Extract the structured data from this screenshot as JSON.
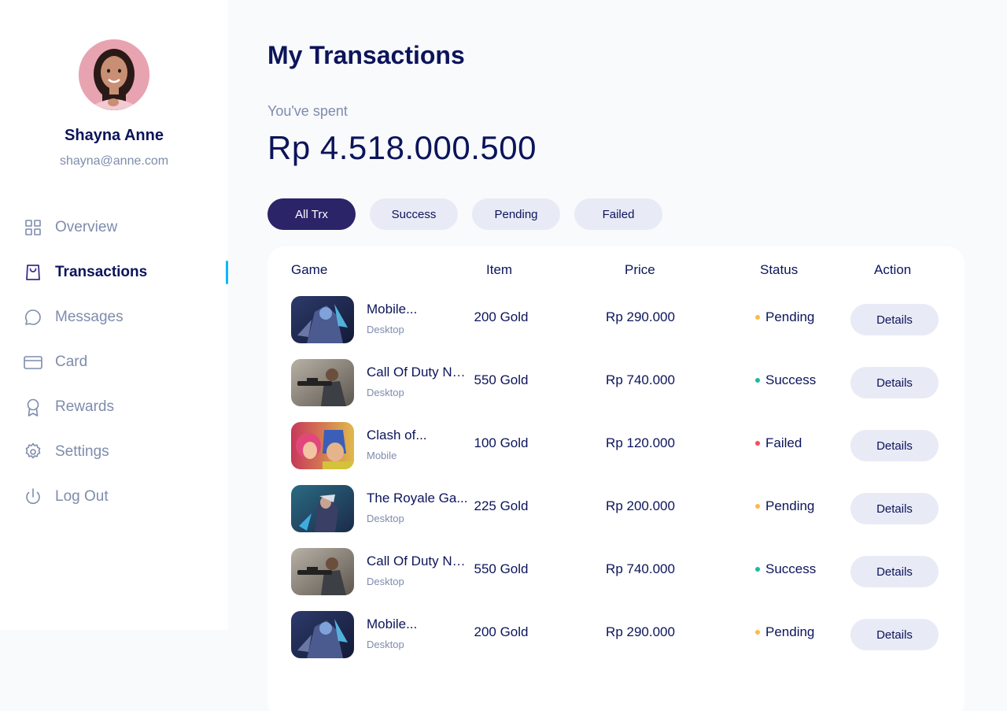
{
  "profile": {
    "name": "Shayna Anne",
    "email": "shayna@anne.com"
  },
  "nav": {
    "items": [
      {
        "label": "Overview",
        "icon": "grid-icon",
        "active": false
      },
      {
        "label": "Transactions",
        "icon": "shopping-bag-icon",
        "active": true
      },
      {
        "label": "Messages",
        "icon": "chat-bubble-icon",
        "active": false
      },
      {
        "label": "Card",
        "icon": "credit-card-icon",
        "active": false
      },
      {
        "label": "Rewards",
        "icon": "award-ribbon-icon",
        "active": false
      },
      {
        "label": "Settings",
        "icon": "gear-icon",
        "active": false
      },
      {
        "label": "Log Out",
        "icon": "power-icon",
        "active": false
      }
    ]
  },
  "page": {
    "title": "My Transactions",
    "spent_label": "You've spent",
    "spent_value": "Rp 4.518.000.500"
  },
  "filters": {
    "items": [
      "All Trx",
      "Success",
      "Pending",
      "Failed"
    ],
    "active_index": 0
  },
  "table": {
    "headers": {
      "game": "Game",
      "item": "Item",
      "price": "Price",
      "status": "Status",
      "action": "Action"
    },
    "rows": [
      {
        "game": "Mobile...",
        "platform": "Desktop",
        "item": "200 Gold",
        "price": "Rp 290.000",
        "status": "Pending",
        "action": "Details",
        "thumb": "mobile-legends-thumbnail"
      },
      {
        "game": "Call Of Duty Ne...",
        "platform": "Desktop",
        "item": "550 Gold",
        "price": "Rp 740.000",
        "status": "Success",
        "action": "Details",
        "thumb": "call-of-duty-thumbnail"
      },
      {
        "game": "Clash of...",
        "platform": "Mobile",
        "item": "100 Gold",
        "price": "Rp 120.000",
        "status": "Failed",
        "action": "Details",
        "thumb": "clash-of-clans-thumbnail"
      },
      {
        "game": "The Royale Ga...",
        "platform": "Desktop",
        "item": "225 Gold",
        "price": "Rp 200.000",
        "status": "Pending",
        "action": "Details",
        "thumb": "royale-game-thumbnail"
      },
      {
        "game": "Call Of Duty Ne...",
        "platform": "Desktop",
        "item": "550 Gold",
        "price": "Rp 740.000",
        "status": "Success",
        "action": "Details",
        "thumb": "call-of-duty-thumbnail"
      },
      {
        "game": "Mobile...",
        "platform": "Desktop",
        "item": "200 Gold",
        "price": "Rp 290.000",
        "status": "Pending",
        "action": "Details",
        "thumb": "mobile-legends-thumbnail"
      }
    ]
  },
  "colors": {
    "primary": "#0c145a",
    "accent": "#2b2468",
    "indicator": "#00bafa",
    "muted": "#7e8cac",
    "pill": "#e8eaf6",
    "status_pending": "#feb94a",
    "status_success": "#1abc9c",
    "status_failed": "#fe4a55"
  }
}
